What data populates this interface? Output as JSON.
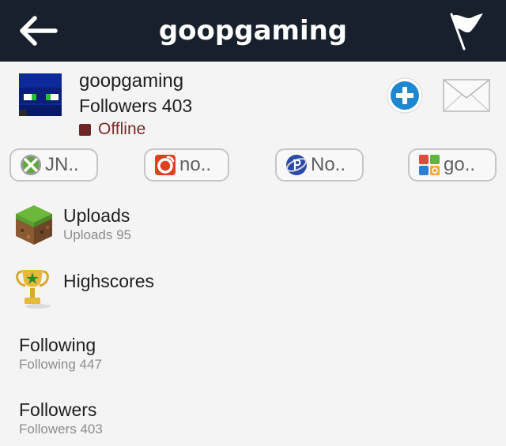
{
  "header": {
    "title": "goopgaming",
    "bg_color": "#17202c"
  },
  "profile": {
    "name": "goopgaming",
    "followers_text": "Followers 403",
    "status": "Offline",
    "status_color": "#6d2424"
  },
  "accounts": [
    {
      "label": "JN..",
      "icon": "xbox-icon"
    },
    {
      "label": "no..",
      "icon": "origin-icon"
    },
    {
      "label": "No..",
      "icon": "playstation-network-icon"
    },
    {
      "label": "go..",
      "icon": "game-center-icon"
    }
  ],
  "menu": [
    {
      "title": "Uploads",
      "subtitle": "Uploads 95",
      "icon": "minecraft-block-icon"
    },
    {
      "title": "Highscores",
      "subtitle": "",
      "icon": "trophy-icon"
    },
    {
      "title": "Following",
      "subtitle": "Following 447"
    },
    {
      "title": "Followers",
      "subtitle": "Followers 403"
    }
  ]
}
